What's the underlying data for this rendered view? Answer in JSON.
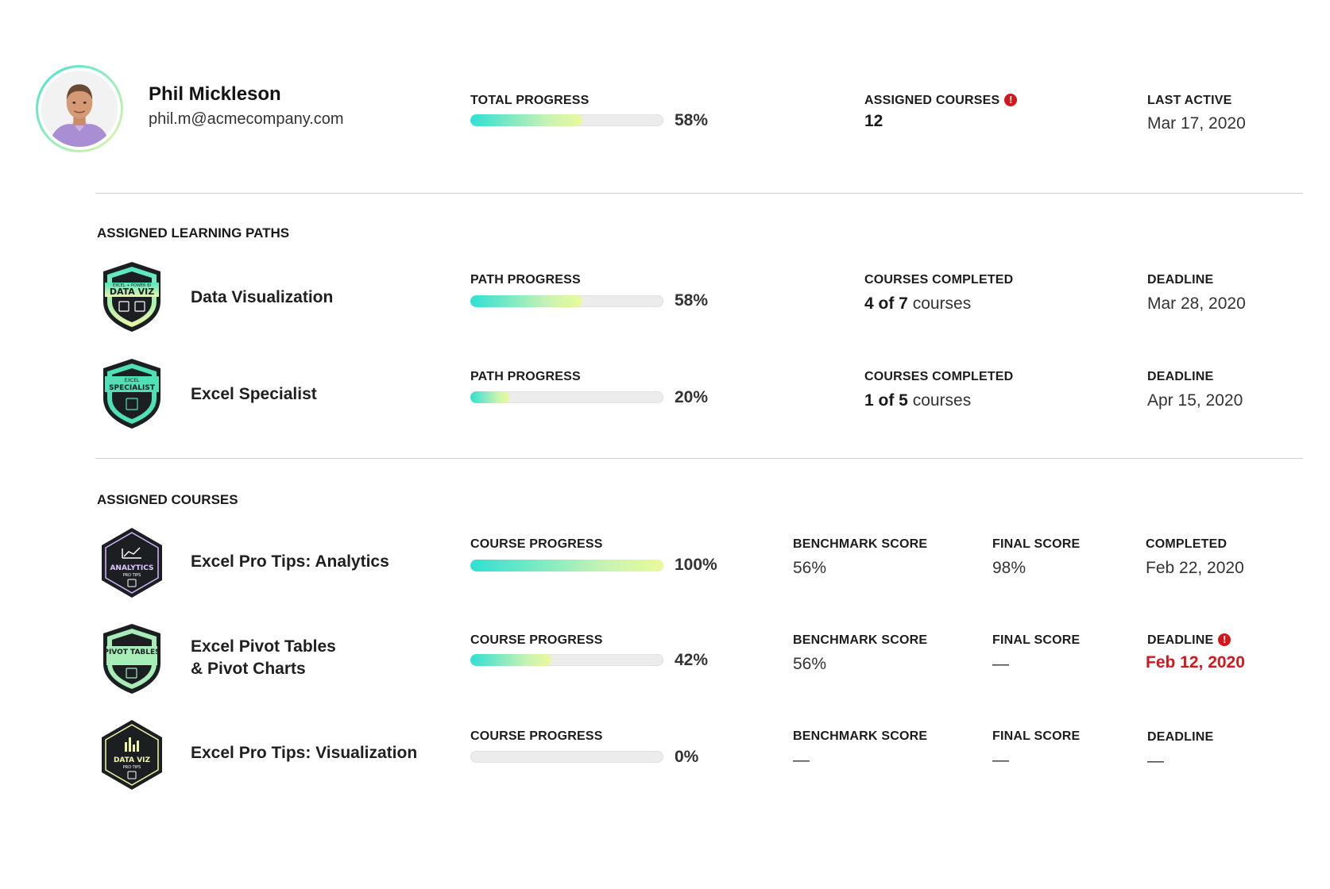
{
  "user": {
    "name": "Phil Mickleson",
    "email": "phil.m@acmecompany.com",
    "total_progress_label": "TOTAL PROGRESS",
    "total_progress_pct": "58%",
    "total_progress_value": 0.58,
    "assigned_courses_label": "ASSIGNED COURSES",
    "assigned_courses_count": "12",
    "last_active_label": "LAST ACTIVE",
    "last_active_value": "Mar 17, 2020"
  },
  "learning_paths": {
    "title": "ASSIGNED LEARNING PATHS",
    "items": [
      {
        "badge_top": "EXCEL + POWER BI",
        "badge_main": "DATA VIZ",
        "title": "Data Visualization",
        "progress_label": "PATH PROGRESS",
        "progress_pct": "58%",
        "progress_value": 0.58,
        "completed_label": "COURSES COMPLETED",
        "completed_count": "4 of 7",
        "completed_suffix": " courses",
        "deadline_label": "DEADLINE",
        "deadline_value": "Mar 28, 2020"
      },
      {
        "badge_top": "EXCEL",
        "badge_main": "SPECIALIST",
        "title": "Excel Specialist",
        "progress_label": "PATH PROGRESS",
        "progress_pct": "20%",
        "progress_value": 0.2,
        "completed_label": "COURSES COMPLETED",
        "completed_count": "1 of 5",
        "completed_suffix": " courses",
        "deadline_label": "DEADLINE",
        "deadline_value": "Apr 15, 2020"
      }
    ]
  },
  "courses": {
    "title": "ASSIGNED COURSES",
    "items": [
      {
        "badge_main": "ANALYTICS",
        "badge_sub": "PRO TIPS",
        "title": "Excel Pro Tips: Analytics",
        "progress_label": "COURSE PROGRESS",
        "progress_pct": "100%",
        "progress_value": 1.0,
        "benchmark_label": "BENCHMARK SCORE",
        "benchmark_value": "56%",
        "final_label": "FINAL SCORE",
        "final_value": "98%",
        "status_label": "COMPLETED",
        "status_value": "Feb 22, 2020"
      },
      {
        "badge_main": "PIVOT TABLES",
        "title_line1": "Excel Pivot Tables",
        "title_line2": "& Pivot Charts",
        "progress_label": "COURSE PROGRESS",
        "progress_pct": "42%",
        "progress_value": 0.42,
        "benchmark_label": "BENCHMARK SCORE",
        "benchmark_value": "56%",
        "final_label": "FINAL SCORE",
        "final_value": "—",
        "status_label": "DEADLINE",
        "status_value": "Feb 12, 2020"
      },
      {
        "badge_main": "DATA VIZ",
        "badge_sub": "PRO TIPS",
        "title": "Excel Pro Tips: Visualization",
        "progress_label": "COURSE PROGRESS",
        "progress_pct": "0%",
        "progress_value": 0.0,
        "benchmark_label": "BENCHMARK SCORE",
        "benchmark_value": "—",
        "final_label": "FINAL SCORE",
        "final_value": "—",
        "status_label": "DEADLINE",
        "status_value": "—"
      }
    ]
  },
  "colors": {
    "accent_start": "#2fe0d3",
    "accent_end": "#e9fa9a",
    "alert_red": "#d3171c",
    "divider": "#d0d0d0"
  }
}
